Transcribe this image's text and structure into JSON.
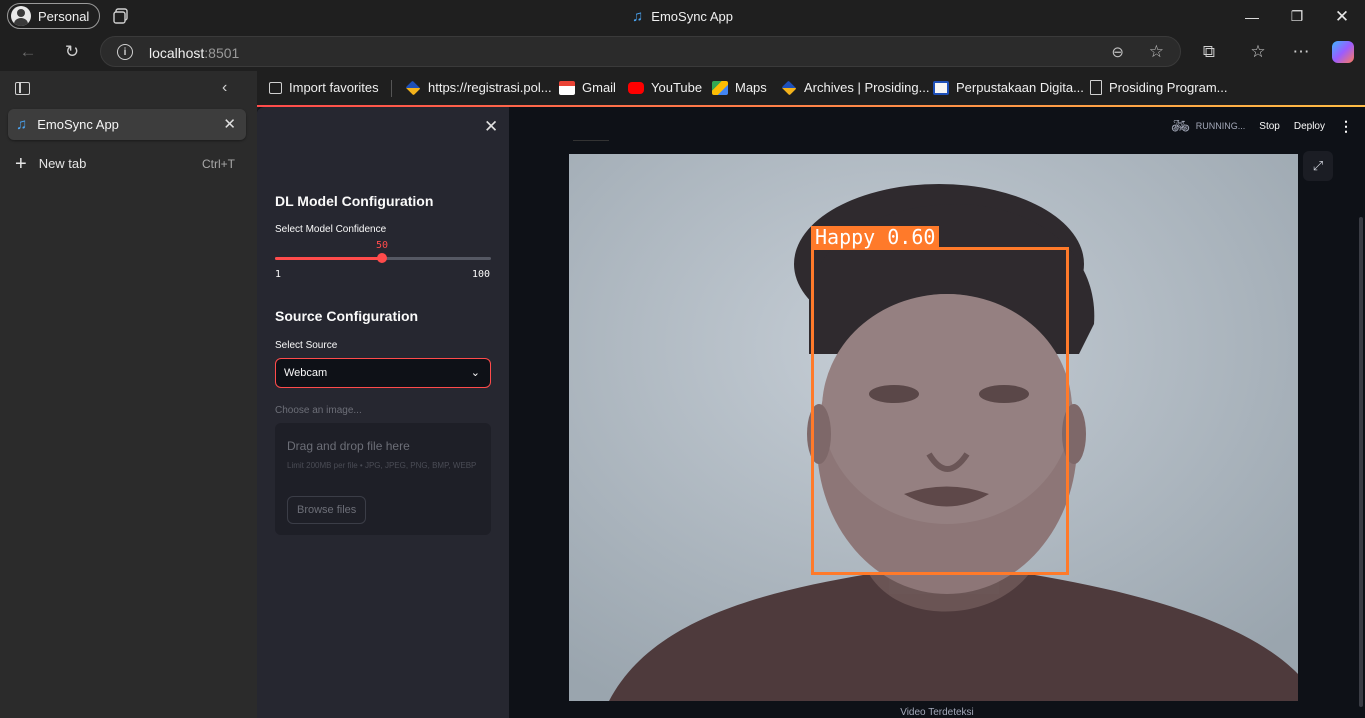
{
  "browser": {
    "profile_label": "Personal",
    "window_title": "EmoSync App",
    "url_host": "localhost",
    "url_port": ":8501"
  },
  "vertical_tabs": {
    "active_tab_title": "EmoSync App",
    "new_tab_label": "New tab",
    "new_tab_shortcut": "Ctrl+T"
  },
  "favorites": [
    {
      "label": "Import favorites",
      "icon": "import-icon"
    },
    {
      "label": "https://registrasi.pol...",
      "icon": "site-icon"
    },
    {
      "label": "Gmail",
      "icon": "gmail-icon"
    },
    {
      "label": "YouTube",
      "icon": "youtube-icon"
    },
    {
      "label": "Maps",
      "icon": "maps-icon"
    },
    {
      "label": "Archives | Prosiding...",
      "icon": "site-icon"
    },
    {
      "label": "Perpustakaan Digita...",
      "icon": "library-icon"
    },
    {
      "label": "Prosiding Program...",
      "icon": "document-icon"
    }
  ],
  "app": {
    "sidebar": {
      "model_header": "DL Model Configuration",
      "confidence_label": "Select Model Confidence",
      "confidence_value": 50,
      "confidence_min": 1,
      "confidence_max": 100,
      "source_header": "Source Configuration",
      "source_label": "Select Source",
      "source_selected": "Webcam",
      "choose_image_label": "Choose an image...",
      "dropzone_title": "Drag and drop file here",
      "dropzone_subtitle": "Limit 200MB per file • JPG, JPEG, PNG, BMP, WEBP",
      "browse_button": "Browse files"
    },
    "header": {
      "running_label": "RUNNING...",
      "stop_label": "Stop",
      "deploy_label": "Deploy"
    },
    "detection": {
      "label": "Happy 0.60"
    },
    "video_caption": "Video Terdeteksi"
  },
  "colors": {
    "accent": "#ff4b4b",
    "bbox": "#ff7a2a",
    "app_bg": "#0e1117",
    "app_sidebar_bg": "#262730"
  }
}
